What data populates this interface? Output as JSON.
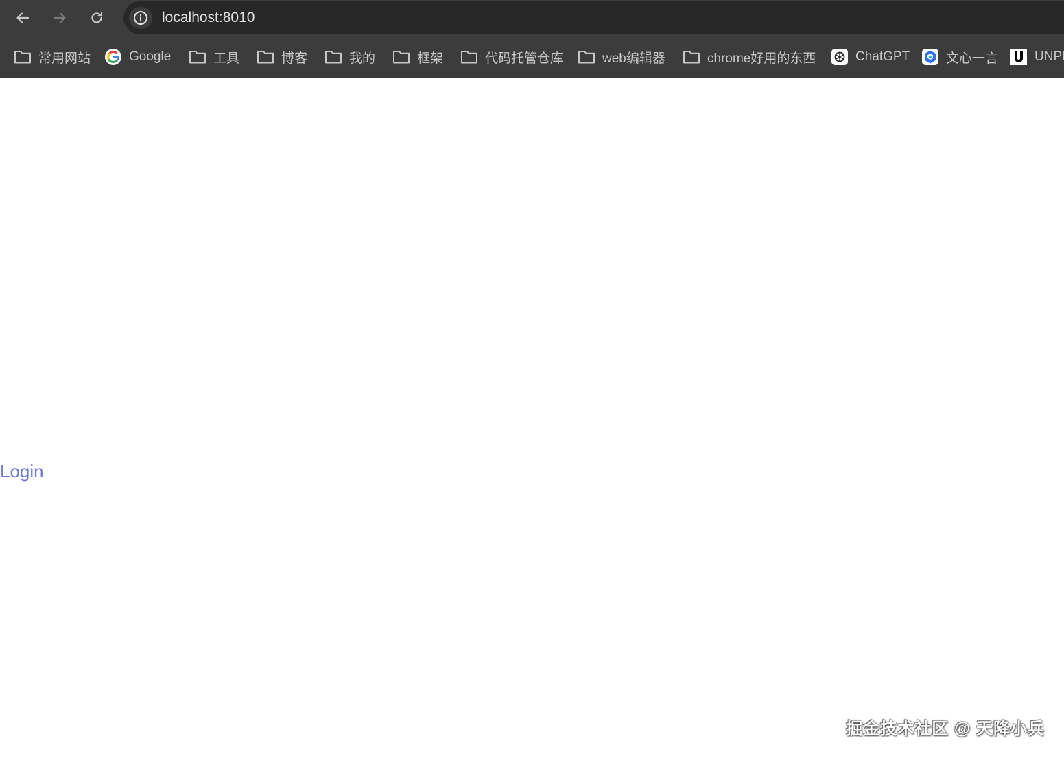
{
  "browser": {
    "url": "localhost:8010",
    "nav": {
      "back_icon": "arrow-left-icon",
      "forward_icon": "arrow-right-icon",
      "reload_icon": "reload-icon",
      "site_info_icon": "info-icon"
    },
    "bookmarks": [
      {
        "label": "常用网站",
        "icon": "folder-icon"
      },
      {
        "label": "Google",
        "icon": "google-icon"
      },
      {
        "label": "工具",
        "icon": "folder-icon"
      },
      {
        "label": "博客",
        "icon": "folder-icon"
      },
      {
        "label": "我的",
        "icon": "folder-icon"
      },
      {
        "label": "框架",
        "icon": "folder-icon"
      },
      {
        "label": "代码托管仓库",
        "icon": "folder-icon"
      },
      {
        "label": "web编辑器",
        "icon": "folder-icon"
      },
      {
        "label": "chrome好用的东西",
        "icon": "folder-icon"
      },
      {
        "label": "ChatGPT",
        "icon": "chatgpt-icon"
      },
      {
        "label": "文心一言",
        "icon": "wenxin-icon"
      },
      {
        "label": "UNPK",
        "icon": "unpkg-icon"
      }
    ]
  },
  "page": {
    "login_link": "Login",
    "link_color": "#6a78e0"
  },
  "watermark": "掘金技术社区 @ 天降小兵"
}
